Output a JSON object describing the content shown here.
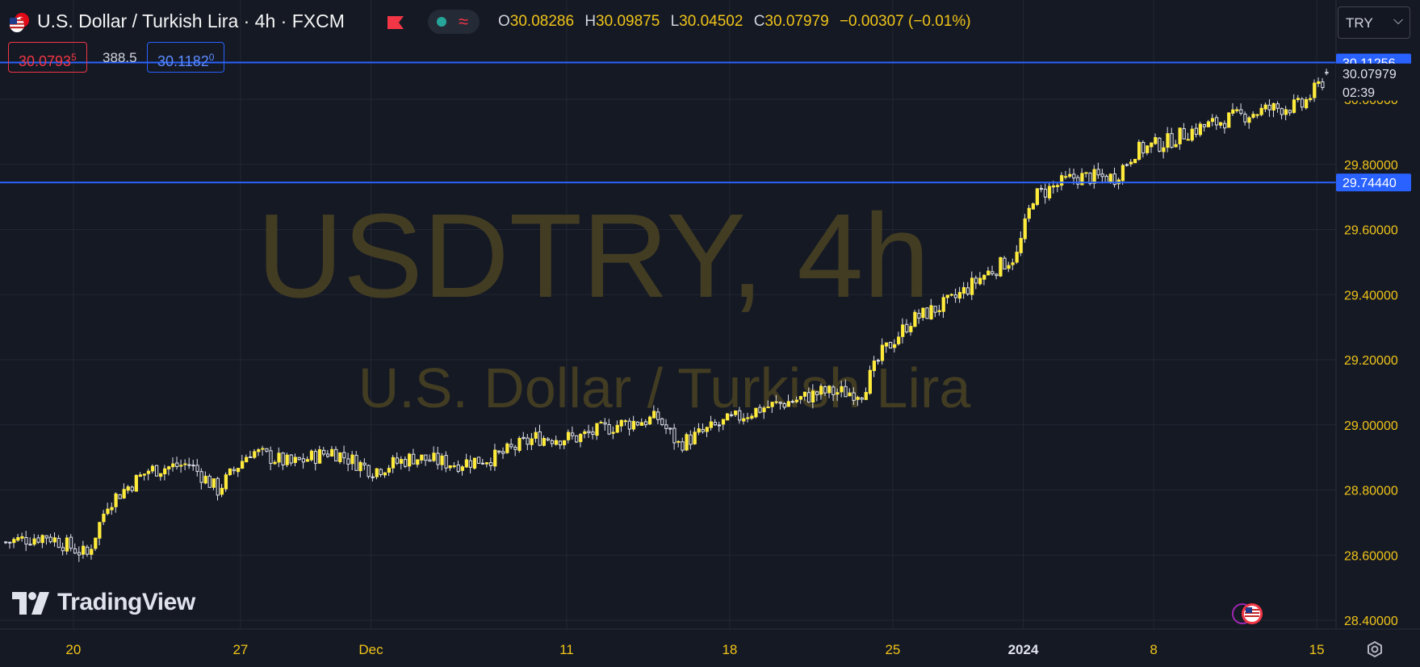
{
  "header": {
    "title": "U.S. Dollar / Turkish Lira · 4h · FXCM",
    "ohlc": [
      {
        "k": "O",
        "v": "30.08286"
      },
      {
        "k": "H",
        "v": "30.09875"
      },
      {
        "k": "L",
        "v": "30.04502"
      },
      {
        "k": "C",
        "v": "30.07979"
      },
      {
        "k": "",
        "v": "−0.00307 (−0.01%)"
      }
    ],
    "pill_icon": "≈"
  },
  "trade": {
    "bid": "30.0793",
    "bid_sup": "5",
    "spread": "388.5",
    "ask": "30.1182",
    "ask_sup": "0"
  },
  "currency": {
    "label": "TRY",
    "chevron": "⌵"
  },
  "watermark": {
    "symbol": "USDTRY, 4h",
    "name": "U.S. Dollar / Turkish Lira"
  },
  "brand": {
    "name": "TradingView"
  },
  "colors": {
    "background": "#151924",
    "candle": "#ffeb3b",
    "axis_text": "#f0c419",
    "line": "#2962ff",
    "price_label": "#2962ff"
  },
  "chart_data": {
    "type": "candlestick",
    "title": "U.S. Dollar / Turkish Lira · 4h · FXCM",
    "ylim": [
      28.36,
      30.24
    ],
    "y_ticks": [
      "30.00000",
      "29.80000",
      "29.60000",
      "29.40000",
      "29.20000",
      "29.00000",
      "28.80000",
      "28.60000",
      "28.40000"
    ],
    "y_tick_values": [
      30.0,
      29.8,
      29.6,
      29.4,
      29.2,
      29.0,
      28.8,
      28.6,
      28.4
    ],
    "x_ticks": [
      "20",
      "27",
      "Dec",
      "11",
      "18",
      "25",
      "2024",
      "8",
      "15"
    ],
    "x_tick_bold": [
      false,
      false,
      false,
      false,
      false,
      false,
      true,
      false,
      false
    ],
    "x_tick_bar_index": [
      17,
      58,
      90,
      138,
      178,
      218,
      250,
      282,
      322
    ],
    "grid": true,
    "horizontal_lines": [
      {
        "value": 30.11256,
        "label": "30.11256"
      },
      {
        "value": 29.7444,
        "label": "29.74440"
      }
    ],
    "last_price": {
      "value": 30.07979,
      "label": "30.07979",
      "countdown": "02:39"
    },
    "series_anchors": [
      [
        0,
        28.64
      ],
      [
        10,
        28.66
      ],
      [
        20,
        28.6
      ],
      [
        25,
        28.76
      ],
      [
        35,
        28.86
      ],
      [
        45,
        28.88
      ],
      [
        52,
        28.8
      ],
      [
        60,
        28.92
      ],
      [
        70,
        28.88
      ],
      [
        80,
        28.92
      ],
      [
        90,
        28.86
      ],
      [
        100,
        28.9
      ],
      [
        110,
        28.88
      ],
      [
        120,
        28.9
      ],
      [
        130,
        28.96
      ],
      [
        140,
        28.96
      ],
      [
        150,
        29.0
      ],
      [
        160,
        29.02
      ],
      [
        165,
        28.94
      ],
      [
        175,
        29.0
      ],
      [
        185,
        29.05
      ],
      [
        195,
        29.08
      ],
      [
        200,
        29.1
      ],
      [
        210,
        29.1
      ],
      [
        215,
        29.22
      ],
      [
        222,
        29.32
      ],
      [
        232,
        29.38
      ],
      [
        240,
        29.46
      ],
      [
        248,
        29.52
      ],
      [
        252,
        29.7
      ],
      [
        262,
        29.76
      ],
      [
        272,
        29.76
      ],
      [
        277,
        29.84
      ],
      [
        285,
        29.87
      ],
      [
        290,
        29.9
      ],
      [
        300,
        29.94
      ],
      [
        310,
        29.97
      ],
      [
        318,
        29.98
      ],
      [
        324,
        30.07
      ]
    ],
    "n_bars": 325,
    "seed": 7
  }
}
